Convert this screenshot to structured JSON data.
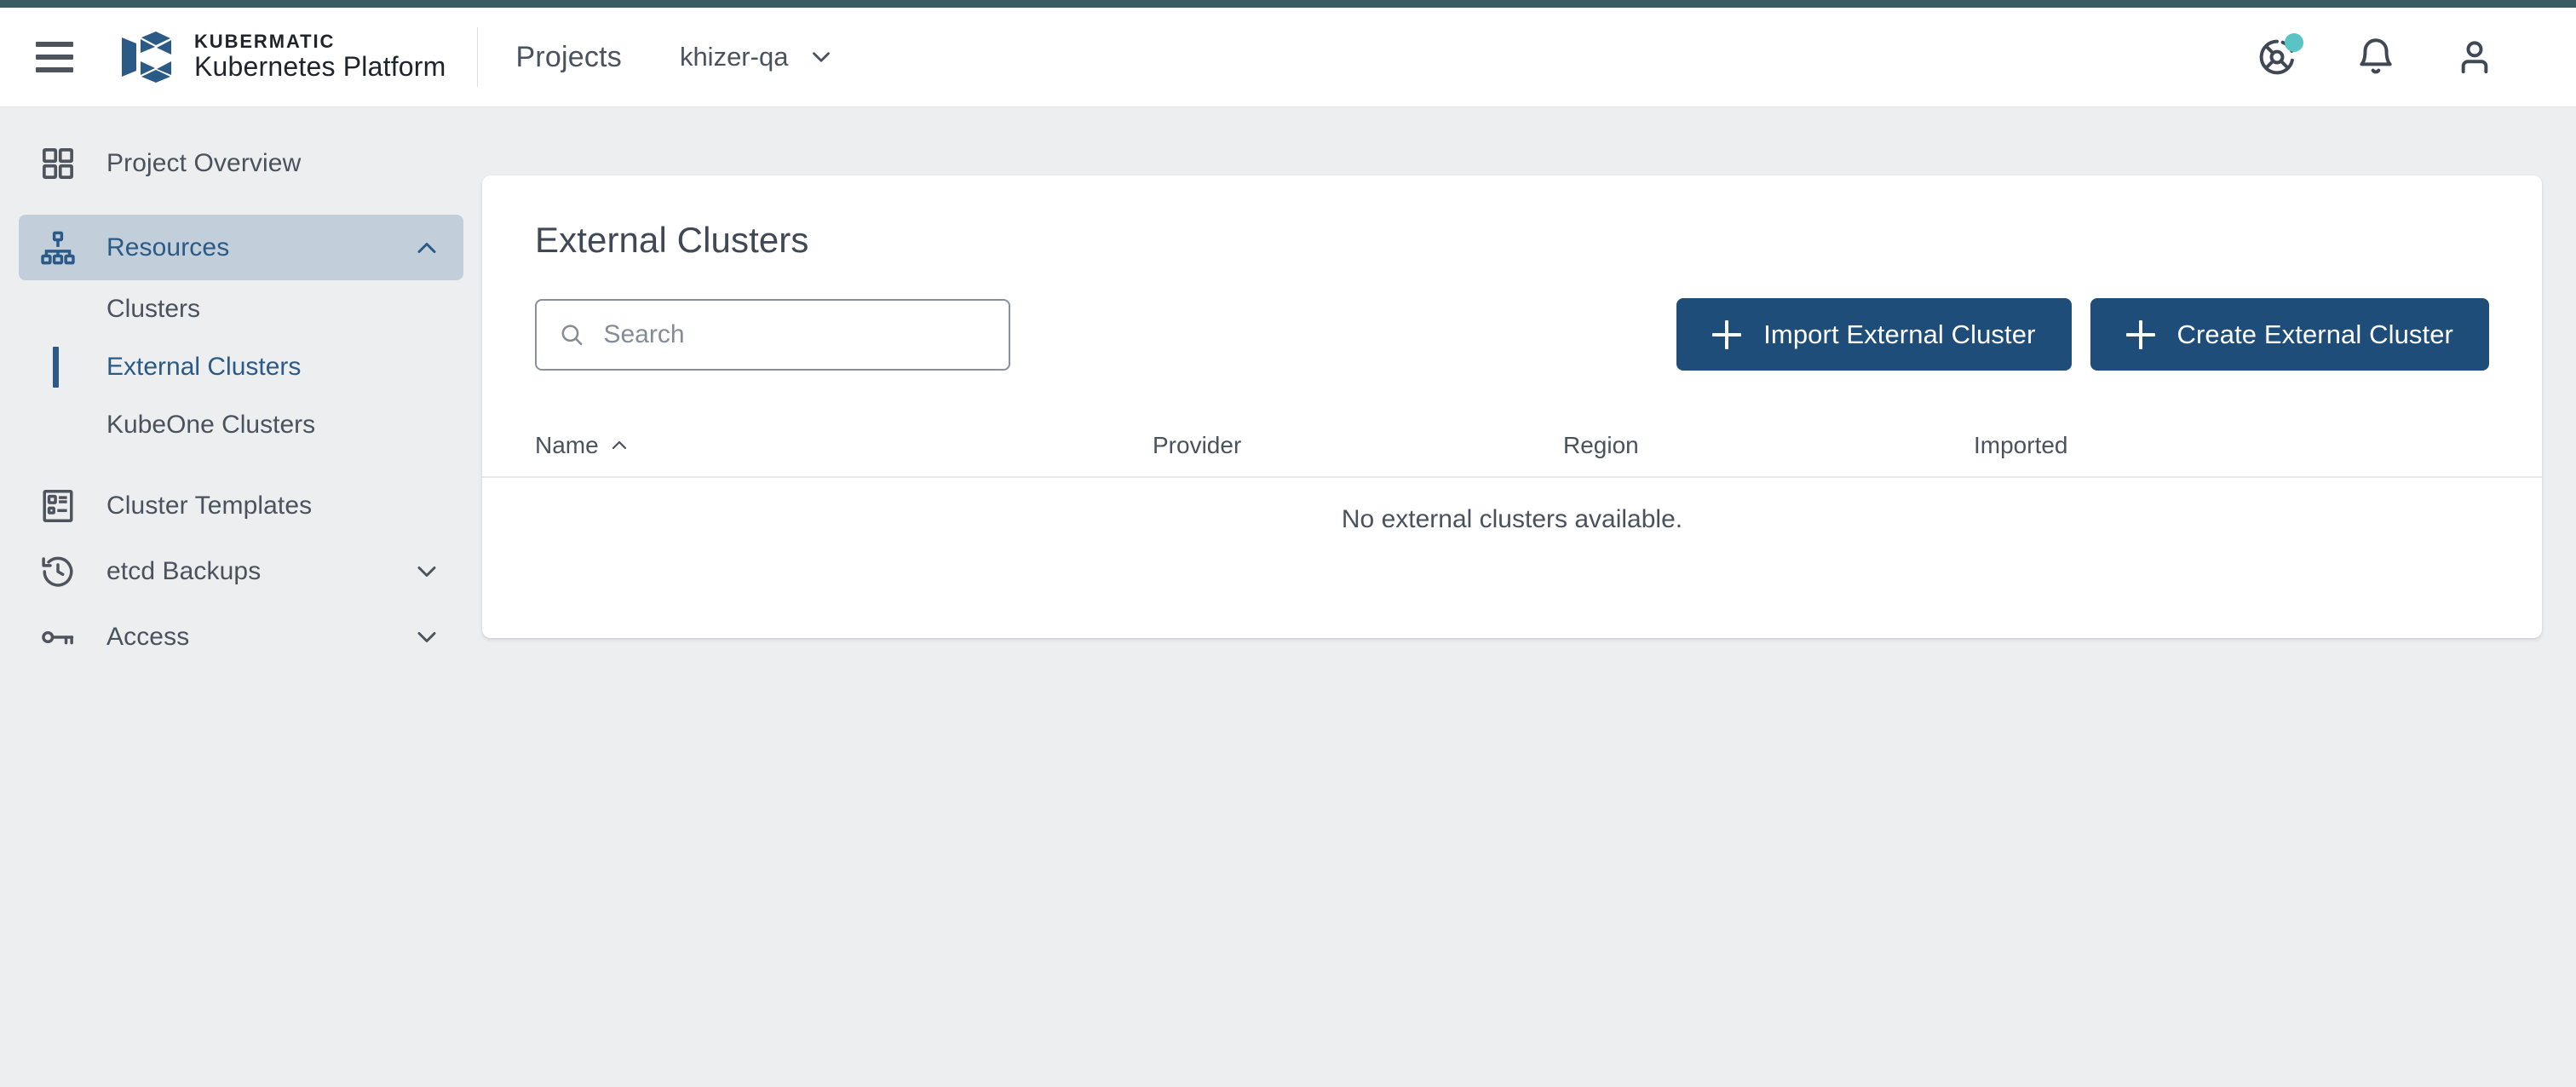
{
  "topbar": {
    "menu_icon": "hamburger-menu-icon",
    "brand_top": "KUBERMATIC",
    "brand_bottom": "Kubernetes Platform",
    "projects_label": "Projects",
    "project_name": "khizer-qa",
    "project_chevron_icon": "chevron-down-icon",
    "help_icon": "help-support-icon",
    "notifications_icon": "bell-icon",
    "account_icon": "user-account-icon",
    "badge_color": "#5ac4c4",
    "accent_color": "#395b64"
  },
  "sidebar": {
    "items": [
      {
        "label": "Project Overview",
        "icon": "grid-dashboard-icon",
        "type": "item",
        "active": false,
        "expandable": false
      },
      {
        "label": "Resources",
        "icon": "sitemap-hierarchy-icon",
        "type": "item",
        "active": true,
        "expandable": true,
        "chevron": "chevron-up-icon"
      },
      {
        "label": "Clusters",
        "type": "sub",
        "active": false
      },
      {
        "label": "External Clusters",
        "type": "sub",
        "active": true
      },
      {
        "label": "KubeOne Clusters",
        "type": "sub",
        "active": false
      },
      {
        "label": "Cluster Templates",
        "icon": "template-document-icon",
        "type": "item",
        "active": false,
        "expandable": false
      },
      {
        "label": "etcd Backups",
        "icon": "history-restore-icon",
        "type": "item",
        "active": false,
        "expandable": true,
        "chevron": "chevron-down-icon"
      },
      {
        "label": "Access",
        "icon": "key-icon",
        "type": "item",
        "active": false,
        "expandable": true,
        "chevron": "chevron-down-icon"
      }
    ]
  },
  "main": {
    "title": "External Clusters",
    "search": {
      "placeholder": "Search",
      "value": "",
      "icon": "search-icon"
    },
    "import_button": {
      "label": "Import External Cluster",
      "icon": "plus-icon"
    },
    "create_button": {
      "label": "Create External Cluster",
      "icon": "plus-icon"
    },
    "table": {
      "columns": [
        {
          "label": "Name",
          "sort_icon": "sort-ascending-icon",
          "sortable": true
        },
        {
          "label": "Provider",
          "sortable": false
        },
        {
          "label": "Region",
          "sortable": false
        },
        {
          "label": "Imported",
          "sortable": false
        }
      ],
      "rows": [],
      "empty_message": "No external clusters available."
    }
  },
  "colors": {
    "primary_button": "#1f4d7a",
    "active_nav_bg": "#c2cfdb",
    "active_nav_text": "#2a5a85",
    "page_background": "#eceef0",
    "card_background": "#ffffff"
  }
}
